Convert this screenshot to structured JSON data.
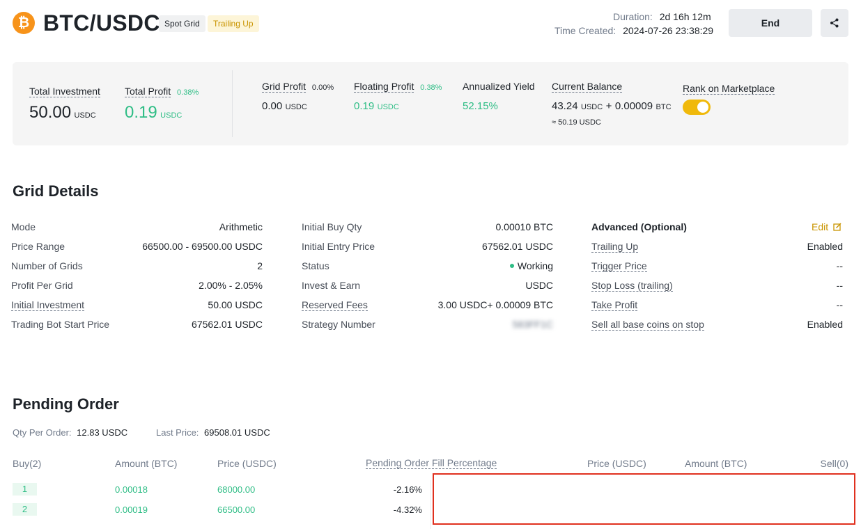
{
  "header": {
    "coin_symbol": "₿",
    "pair": "BTC/USDC",
    "tag_type": "Spot Grid",
    "tag_mode": "Trailing Up",
    "duration_label": "Duration:",
    "duration_value": "2d 16h 12m",
    "created_label": "Time Created:",
    "created_value": "2024-07-26 23:38:29",
    "end_label": "End",
    "share_icon": "share-icon"
  },
  "summary": {
    "total_investment_label": "Total Investment",
    "total_investment_value": "50.00",
    "total_investment_unit": "USDC",
    "total_profit_label": "Total Profit",
    "total_profit_pct": "0.38%",
    "total_profit_value": "0.19",
    "total_profit_unit": "USDC",
    "grid_profit_label": "Grid Profit",
    "grid_profit_pct": "0.00%",
    "grid_profit_value": "0.00",
    "grid_profit_unit": "USDC",
    "floating_profit_label": "Floating Profit",
    "floating_profit_pct": "0.38%",
    "floating_profit_value": "0.19",
    "floating_profit_unit": "USDC",
    "annualized_label": "Annualized Yield",
    "annualized_value": "52.15%",
    "balance_label": "Current Balance",
    "balance_usdc": "43.24",
    "balance_usdc_unit": "USDC",
    "balance_plus": "+",
    "balance_btc": "0.00009",
    "balance_btc_unit": "BTC",
    "balance_approx": "≈ 50.19 USDC",
    "rank_label": "Rank on Marketplace",
    "rank_enabled": true,
    "accent_color": "#f0b90b",
    "profit_color": "#2ebd85"
  },
  "grid_details": {
    "title": "Grid Details",
    "col1": [
      {
        "label": "Mode",
        "value": "Arithmetic"
      },
      {
        "label": "Price Range",
        "value": "66500.00 - 69500.00 USDC"
      },
      {
        "label": "Number of Grids",
        "value": "2"
      },
      {
        "label": "Profit Per Grid",
        "value": "2.00% - 2.05%"
      },
      {
        "label": "Initial Investment",
        "value": "50.00 USDC"
      },
      {
        "label": "Trading Bot Start Price",
        "value": "67562.01 USDC"
      }
    ],
    "col2": [
      {
        "label": "Initial Buy Qty",
        "value": "0.00010 BTC"
      },
      {
        "label": "Initial Entry Price",
        "value": "67562.01 USDC"
      },
      {
        "label": "Status",
        "value": "Working"
      },
      {
        "label": "Invest & Earn",
        "value": "USDC"
      },
      {
        "label": "Reserved Fees",
        "value": "3.00 USDC+ 0.00009 BTC"
      },
      {
        "label": "Strategy Number",
        "value": "583FF1C"
      }
    ],
    "col3_header": "Advanced (Optional)",
    "edit_label": "Edit",
    "col3": [
      {
        "label": "Trailing Up",
        "value": "Enabled"
      },
      {
        "label": "Trigger Price",
        "value": "--"
      },
      {
        "label": "Stop Loss (trailing)",
        "value": "--"
      },
      {
        "label": "Take Profit",
        "value": "--"
      },
      {
        "label": "Sell all base coins on stop",
        "value": "Enabled"
      }
    ]
  },
  "pending": {
    "title": "Pending Order",
    "qty_label": "Qty Per Order:",
    "qty_value": "12.83 USDC",
    "last_label": "Last Price:",
    "last_value": "69508.01 USDC",
    "headers": {
      "buy": "Buy(2)",
      "amount_buy": "Amount (BTC)",
      "price_buy": "Price (USDC)",
      "fill": "Pending Order Fill Percentage",
      "price_sell": "Price (USDC)",
      "amount_sell": "Amount (BTC)",
      "sell": "Sell(0)"
    },
    "buy_rows": [
      {
        "index": "1",
        "amount": "0.00018",
        "price": "68000.00",
        "fill": "-2.16%"
      },
      {
        "index": "2",
        "amount": "0.00019",
        "price": "66500.00",
        "fill": "-4.32%"
      }
    ]
  }
}
